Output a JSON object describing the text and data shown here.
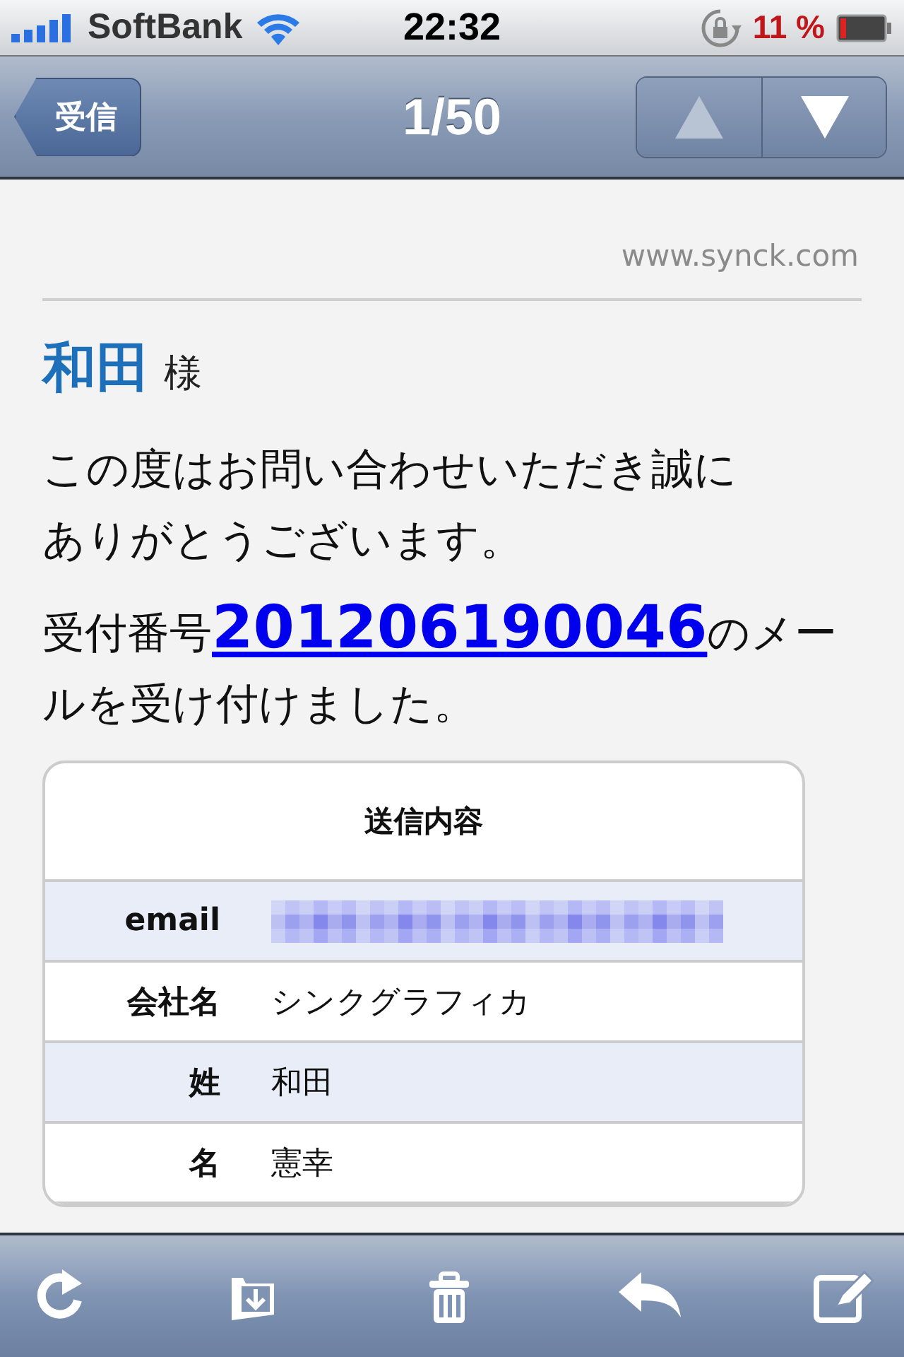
{
  "status_bar": {
    "carrier": "SoftBank",
    "time": "22:32",
    "battery": "11 %"
  },
  "nav_bar": {
    "back": "受信",
    "title": "1/50",
    "arrows": [
      {
        "kind": "up",
        "disabled": true
      },
      {
        "kind": "down",
        "disabled": false
      }
    ]
  },
  "message": {
    "source": "www.synck.com",
    "name": "和田",
    "honorific": "様",
    "greeting": "この度はお問い合わせいただき誠にありがとうございます。",
    "receipt_prefix": "受付番号",
    "receipt_number": "201206190046",
    "receipt_suffix": "のメールを受け付けました。",
    "table": {
      "title": "送信内容",
      "rows": [
        {
          "label": "email",
          "kind": "redacted"
        },
        {
          "label": "会社名",
          "kind": "text",
          "value": "シンクグラフィカ"
        },
        {
          "label": "姓",
          "kind": "text",
          "value": "和田"
        },
        {
          "label": "名",
          "kind": "text",
          "value": "憲幸"
        }
      ]
    }
  },
  "toolbar": {
    "buttons": [
      {
        "kind": "refresh"
      },
      {
        "kind": "move"
      },
      {
        "kind": "trash"
      },
      {
        "kind": "reply"
      },
      {
        "kind": "compose"
      }
    ]
  }
}
